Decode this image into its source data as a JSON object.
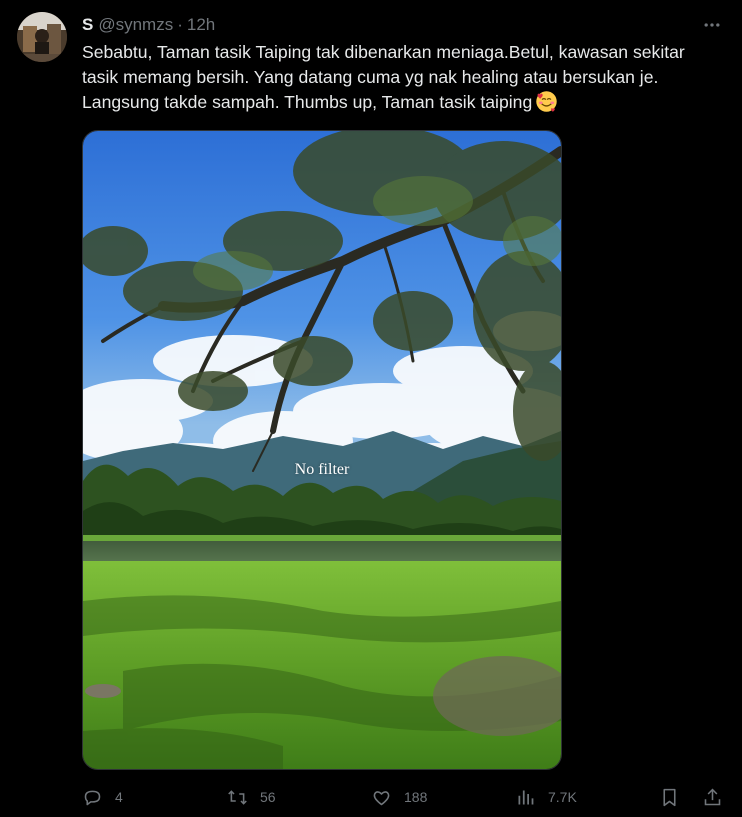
{
  "tweet": {
    "display_name": "S",
    "handle": "@synmzs",
    "separator": "·",
    "time": "12h",
    "text": "Sebabtu, Taman tasik Taiping tak dibenarkan meniaga.Betul, kawasan sekitar tasik memang bersih. Yang datang cuma yg nak healing atau bersukan je. Langsung takde sampah. Thumbs up, Taman tasik taiping",
    "text_emoji": "smiling-face-with-hearts-emoji"
  },
  "media": {
    "overlay_text": "No filter"
  },
  "actions": {
    "replies": "4",
    "reposts": "56",
    "likes": "188",
    "views": "7.7K"
  },
  "icons": {
    "more": "more-horizontal-icon",
    "reply": "reply-icon",
    "repost": "repost-icon",
    "like": "heart-icon",
    "views": "analytics-icon",
    "bookmark": "bookmark-icon",
    "share": "share-icon"
  },
  "colors": {
    "background": "#000000",
    "text": "#e7e9ea",
    "muted": "#71767b",
    "border": "#2f3336"
  }
}
